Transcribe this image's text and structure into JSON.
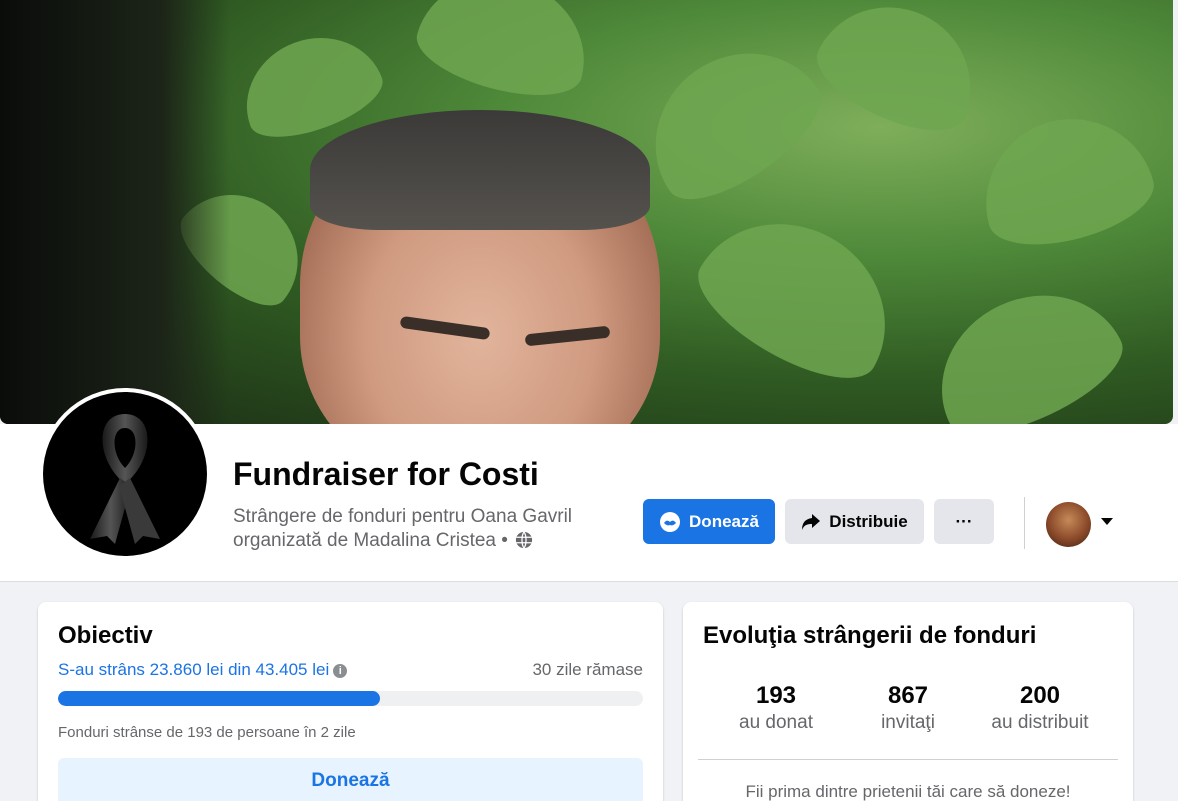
{
  "header": {
    "title": "Fundraiser for Costi",
    "subtitle_line1": "Strângere de fonduri pentru Oana Gavril",
    "subtitle_line2": "organizată de Madalina Cristea •",
    "privacy_icon": "globe-icon"
  },
  "actions": {
    "donate_label": "Donează",
    "share_label": "Distribuie",
    "more_label": "···"
  },
  "goal": {
    "heading": "Obiectiv",
    "raised_text": "S-au strâns 23.860 lei din 43.405 lei",
    "days_remaining": "30 zile rămase",
    "progress_fraction": 0.55,
    "raised_by": "Fonduri strânse de 193 de persoane în 2 zile",
    "donate_label": "Donează"
  },
  "evolution": {
    "heading": "Evoluţia strângerii de fonduri",
    "stats": [
      {
        "value": "193",
        "label": "au donat"
      },
      {
        "value": "867",
        "label": "invitaţi"
      },
      {
        "value": "200",
        "label": "au distribuit"
      }
    ],
    "note": "Fii prima dintre prietenii tăi care să doneze!"
  },
  "colors": {
    "accent": "#1b74e4",
    "background": "#f0f2f5"
  }
}
